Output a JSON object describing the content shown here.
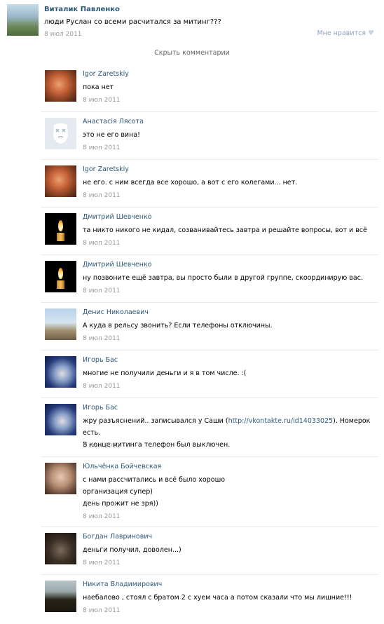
{
  "post": {
    "author": "Виталик Павленко",
    "text": "люди Руслан со всеми расчитался за митинг???",
    "date": "8 июл 2011",
    "like_label": "Мне нравится"
  },
  "hide_comments_label": "Скрыть комментарии",
  "comments": [
    {
      "author": "Igor Zaretskiy",
      "text": "пока нет",
      "date": "8 июл 2011",
      "avatar": "warm"
    },
    {
      "author": "Анастасія Лясота",
      "text": "это не его вина!",
      "date": "8 июл 2011",
      "avatar": "deleted"
    },
    {
      "author": "Igor Zaretskiy",
      "text": "не его. с ним всегда все хорошо, а вот с его колегами... нет.",
      "date": "8 июл 2011",
      "avatar": "warm"
    },
    {
      "author": "Дмитрий Шевченко",
      "text": "та никто никого не кидал, созванивайтесь завтра и решайте вопросы, вот и всё",
      "date": "8 июл 2011",
      "avatar": "candle"
    },
    {
      "author": "Дмитрий Шевченко",
      "text": "ну позвоните ещё завтра, вы просто были в другой группе, скоординирую вас.",
      "date": "8 июл 2011",
      "avatar": "candle"
    },
    {
      "author": "Денис Николаевич",
      "text": "А куда в рельсу звонить? Если телефоны отключины.",
      "date": "8 июл 2011",
      "avatar": "beach"
    },
    {
      "author": "Игорь Бас",
      "text": "многие не получили деньги и я в том числе. :(",
      "date": "8 июл 2011",
      "avatar": "blue"
    },
    {
      "author": "Игорь Бас",
      "text_before": "жру разъяснений.. записывался у Саши (",
      "link": "http://vkontakte.ru/id14033025",
      "text_after": "). Номерок есть.\nВ конце митинга телефон был выключен.",
      "date": "8 июл 2011",
      "avatar": "blue"
    },
    {
      "author": "Юльчёнка Бойчевская",
      "text": "с нами рассчитались и всё было хорошо\nорганизация супер)\nдень прожит не зря))",
      "date": "8 июл 2011",
      "avatar": "girl"
    },
    {
      "author": "Богдан Лавринович",
      "text": "деньги получил, доволен...)",
      "date": "8 июл 2011",
      "avatar": "dark"
    },
    {
      "author": "Никита Владимирович",
      "text": "наебалово , стоял с братом 2 с хуем часа а потом сказали что мы лишние!!!",
      "date": "8 июл 2011",
      "avatar": "man"
    }
  ]
}
